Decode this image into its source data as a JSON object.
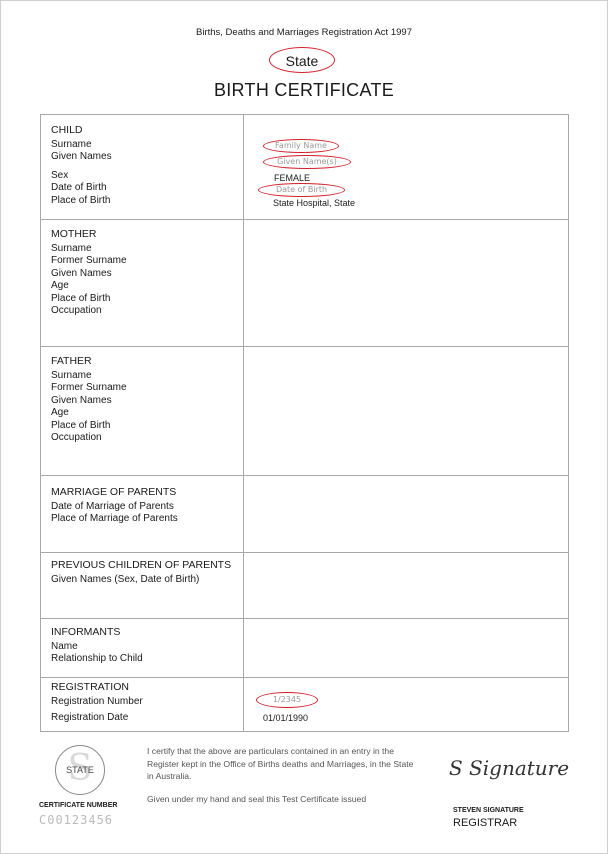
{
  "header": {
    "act": "Births, Deaths and Marriages Registration Act 1997",
    "state": "State",
    "title": "BIRTH CERTIFICATE"
  },
  "child": {
    "heading": "CHILD",
    "surname_label": "Surname",
    "given_names_label": "Given Names",
    "sex_label": "Sex",
    "dob_label": "Date of Birth",
    "pob_label": "Place of Birth",
    "surname_value": "Family Name",
    "given_names_value": "Given Name(s)",
    "sex_value": "FEMALE",
    "dob_value": "Date of Birth",
    "pob_value": "State Hospital, State"
  },
  "mother": {
    "heading": "MOTHER",
    "fields": [
      "Surname",
      "Former Surname",
      "Given Names",
      "Age",
      "Place of Birth",
      "Occupation"
    ]
  },
  "father": {
    "heading": "FATHER",
    "fields": [
      "Surname",
      "Former Surname",
      "Given Names",
      "Age",
      "Place of Birth",
      "Occupation"
    ]
  },
  "marriage": {
    "heading": "MARRIAGE OF PARENTS",
    "fields": [
      "Date of Marriage of Parents",
      "Place of Marriage of Parents"
    ]
  },
  "previous_children": {
    "heading": "PREVIOUS CHILDREN OF PARENTS",
    "fields": [
      "Given Names (Sex, Date of Birth)"
    ]
  },
  "informants": {
    "heading": "INFORMANTS",
    "fields": [
      "Name",
      "Relationship to Child"
    ]
  },
  "registration": {
    "heading": "REGISTRATION",
    "number_label": "Registration Number",
    "date_label": "Registration Date",
    "number_value": "1/2345",
    "date_value": "01/01/1990"
  },
  "footer": {
    "seal_text": "STATE",
    "cert_number_label": "CERTIFICATE NUMBER",
    "cert_number": "C00123456",
    "certify_text": "I certify that the above are particulars contained in an entry in the Register kept in the Office of Births deaths and Marriages, in the State in Australia.",
    "given_text": "Given under my hand and seal this Test Certificate issued",
    "signature": "S Signature",
    "signatory_name": "STEVEN SIGNATURE",
    "signatory_title": "REGISTRAR"
  },
  "colors": {
    "annotation_red": "#d0202a",
    "border": "#a8a8a8"
  }
}
